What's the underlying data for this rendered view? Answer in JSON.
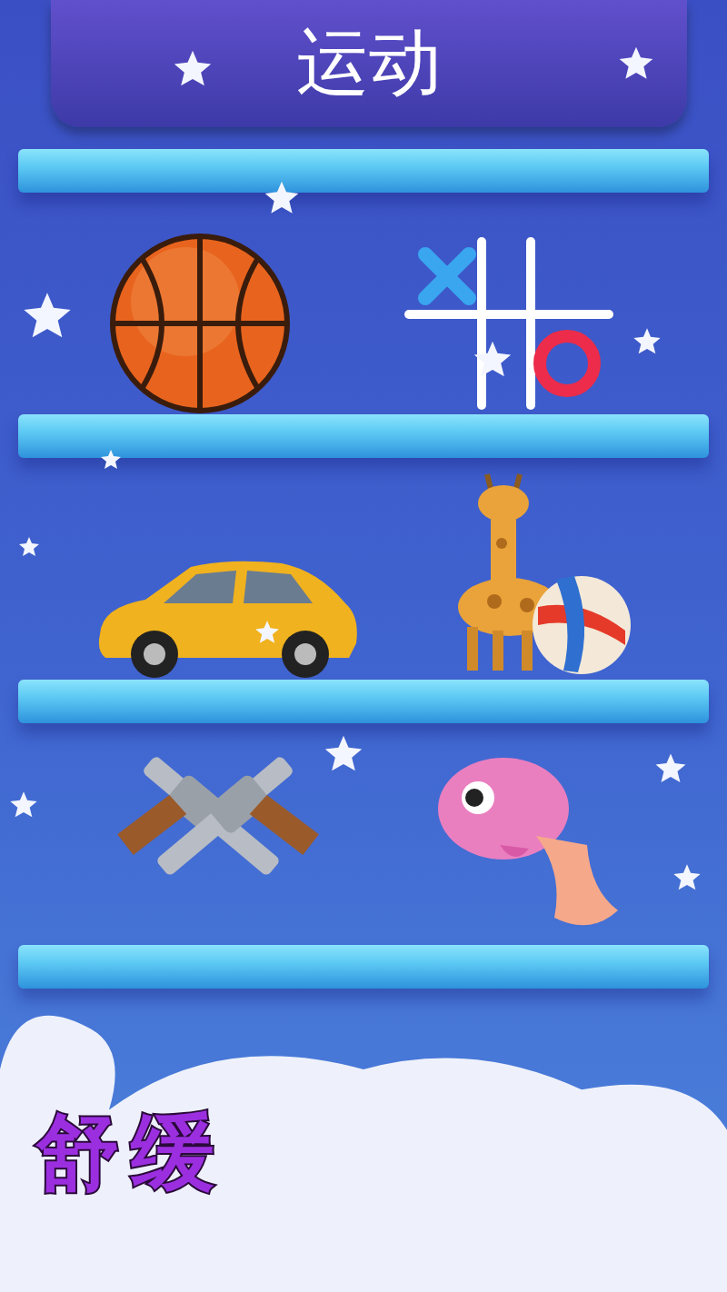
{
  "title": "运动",
  "shelves": [
    {
      "items": [
        {
          "kind": "basketball"
        },
        {
          "kind": "tic-tac-toe"
        }
      ]
    },
    {
      "items": [
        {
          "kind": "car"
        },
        {
          "kind": "giraffe-ball"
        }
      ]
    },
    {
      "items": [
        {
          "kind": "pistols"
        },
        {
          "kind": "fish"
        }
      ]
    }
  ],
  "tagline": "舒缓"
}
